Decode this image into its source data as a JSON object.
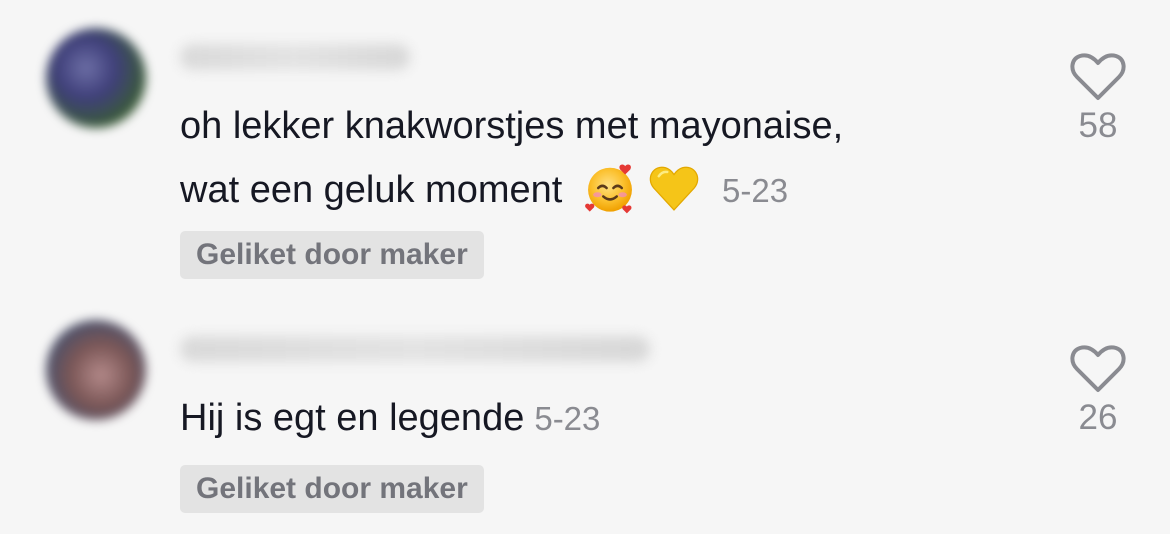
{
  "comments": [
    {
      "text_line1": "oh lekker knakworstjes met mayonaise,",
      "text_line2": "wat een geluk moment",
      "emoji": [
        "smiling-face-with-hearts",
        "yellow-heart"
      ],
      "date": "5-23",
      "badge": "Geliket door maker",
      "like_count": "58"
    },
    {
      "text": "Hij is egt en legende",
      "date": "5-23",
      "badge": "Geliket door maker",
      "like_count": "26"
    }
  ],
  "colors": {
    "background": "#f6f6f6",
    "text": "#161823",
    "muted": "#8a8b91",
    "badge_bg": "#e3e3e3",
    "badge_text": "#73747b",
    "yellow_heart": "#f5c518",
    "emoji_face": "#fbc02d"
  }
}
